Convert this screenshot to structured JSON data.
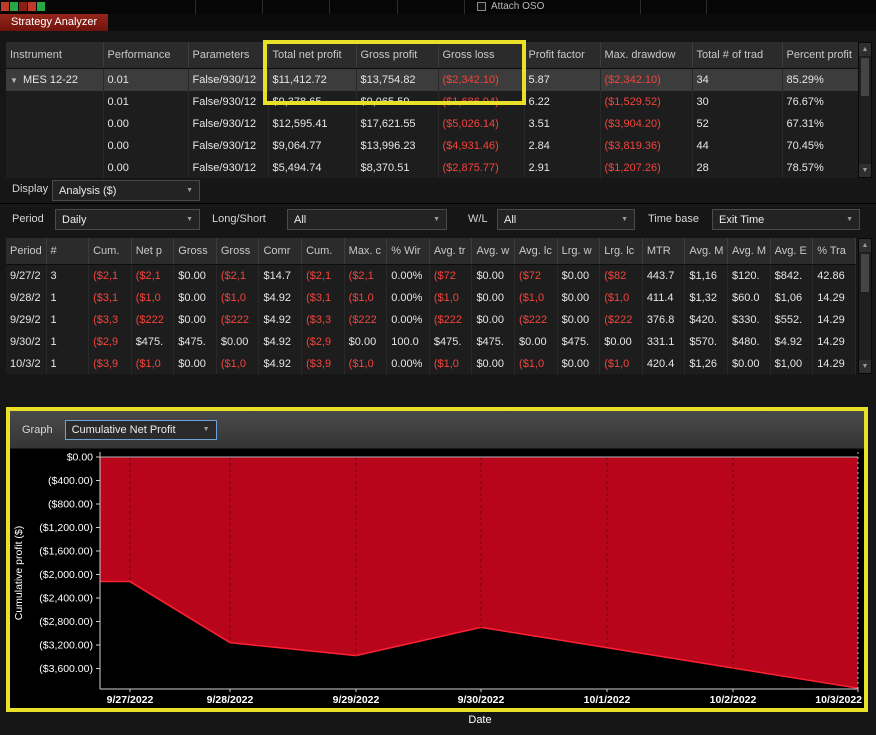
{
  "window": {
    "top_strip": {
      "attach_oso": "Attach OSO",
      "square_colors": [
        "#c0392b",
        "#27a844",
        "#8a1f14",
        "#c0392b",
        "#27a844"
      ]
    },
    "tab": "Strategy Analyzer"
  },
  "colors": {
    "highlight_yellow": "#e9e127",
    "negative_red": "#f2453d",
    "tab_maroon": "#7d1b15",
    "chart_fill": "#b8051c",
    "chart_line": "#ff2233"
  },
  "results_table": {
    "columns": [
      "Instrument",
      "Performance",
      "Parameters",
      "Total net profit",
      "Gross profit",
      "Gross loss",
      "Profit factor",
      "Max. drawdow",
      "Total # of trad",
      "Percent profit"
    ],
    "rows": [
      {
        "selected": true,
        "expanded": true,
        "cells": [
          "MES 12-22",
          "0.01",
          "False/930/12",
          "$11,412.72",
          "$13,754.82",
          "($2,342.10)",
          "5.87",
          "($2,342.10)",
          "34",
          "85.29%"
        ]
      },
      {
        "cells": [
          "",
          "0.01",
          "False/930/12",
          "$9,378.65",
          "$9,065.59",
          "($1,686.94)",
          "6.22",
          "($1,529.52)",
          "30",
          "76.67%"
        ]
      },
      {
        "cells": [
          "",
          "0.00",
          "False/930/12",
          "$12,595.41",
          "$17,621.55",
          "($5,026.14)",
          "3.51",
          "($3,904.20)",
          "52",
          "67.31%"
        ]
      },
      {
        "cells": [
          "",
          "0.00",
          "False/930/12",
          "$9,064.77",
          "$13,996.23",
          "($4,931.46)",
          "2.84",
          "($3,819.36)",
          "44",
          "70.45%"
        ]
      },
      {
        "cells": [
          "",
          "0.00",
          "False/930/12",
          "$5,494.74",
          "$8,370.51",
          "($2,875.77)",
          "2.91",
          "($1,207.26)",
          "28",
          "78.57%"
        ]
      }
    ]
  },
  "display": {
    "label": "Display",
    "value": "Analysis ($)"
  },
  "filters": [
    {
      "label": "Period",
      "value": "Daily"
    },
    {
      "label": "Long/Short",
      "value": "All"
    },
    {
      "label": "W/L",
      "value": "All"
    },
    {
      "label": "Time base",
      "value": "Exit Time"
    }
  ],
  "periods_table": {
    "columns": [
      "Period",
      "#",
      "Cum.",
      "Net p",
      "Gross",
      "Gross",
      "Comr",
      "Cum.",
      "Max. c",
      "% Wir",
      "Avg. tr",
      "Avg. w",
      "Avg. lc",
      "Lrg. w",
      "Lrg. lc",
      "MTR",
      "Avg. M",
      "Avg. M",
      "Avg. E",
      "% Tra"
    ],
    "rows": [
      [
        "9/27/2",
        "3",
        "($2,1",
        "($2,1",
        "$0.00",
        "($2,1",
        "$14.7",
        "($2,1",
        "($2,1",
        "0.00%",
        "($72",
        "$0.00",
        "($72",
        "$0.00",
        "($82",
        "443.7",
        "$1,16",
        "$120.",
        "$842.",
        "42.86"
      ],
      [
        "9/28/2",
        "1",
        "($3,1",
        "($1,0",
        "$0.00",
        "($1,0",
        "$4.92",
        "($3,1",
        "($1,0",
        "0.00%",
        "($1,0",
        "$0.00",
        "($1,0",
        "$0.00",
        "($1,0",
        "411.4",
        "$1,32",
        "$60.0",
        "$1,06",
        "14.29"
      ],
      [
        "9/29/2",
        "1",
        "($3,3",
        "($222",
        "$0.00",
        "($222",
        "$4.92",
        "($3,3",
        "($222",
        "0.00%",
        "($222",
        "$0.00",
        "($222",
        "$0.00",
        "($222",
        "376.8",
        "$420.",
        "$330.",
        "$552.",
        "14.29"
      ],
      [
        "9/30/2",
        "1",
        "($2,9",
        "$475.",
        "$475.",
        "$0.00",
        "$4.92",
        "($2,9",
        "$0.00",
        "100.0",
        "$475.",
        "$475.",
        "$0.00",
        "$475.",
        "$0.00",
        "331.1",
        "$570.",
        "$480.",
        "$4.92",
        "14.29"
      ],
      [
        "10/3/2",
        "1",
        "($3,9",
        "($1,0",
        "$0.00",
        "($1,0",
        "$4.92",
        "($3,9",
        "($1,0",
        "0.00%",
        "($1,0",
        "$0.00",
        "($1,0",
        "$0.00",
        "($1,0",
        "420.4",
        "$1,26",
        "$0.00",
        "$1,00",
        "14.29"
      ]
    ]
  },
  "graph": {
    "label": "Graph",
    "value": "Cumulative Net Profit"
  },
  "chart_data": {
    "type": "area",
    "title": "",
    "xlabel": "Date",
    "ylabel": "Cumulative profit ($)",
    "x_ticks": [
      "9/27/2022",
      "9/28/2022",
      "9/29/2022",
      "9/30/2022",
      "10/1/2022",
      "10/2/2022",
      "10/3/2022"
    ],
    "y_tick_labels": [
      "$0.00",
      "($400.00)",
      "($800.00)",
      "($1,200.00)",
      "($1,600.00)",
      "($2,000.00)",
      "($2,400.00)",
      "($2,800.00)",
      "($3,200.00)",
      "($3,600.00)"
    ],
    "y_tick_values": [
      0,
      -400,
      -800,
      -1200,
      -1600,
      -2000,
      -2400,
      -2800,
      -3200,
      -3600
    ],
    "ylim": [
      -3950,
      0
    ],
    "baseline": 0,
    "grid": "vertical-dashed",
    "legend": "none",
    "series": [
      {
        "name": "Cumulative Net Profit",
        "points": [
          [
            "9/27/2022",
            -2120
          ],
          [
            "9/28/2022",
            -3160
          ],
          [
            "9/29/2022",
            -3380
          ],
          [
            "9/30/2022",
            -2900
          ],
          [
            "10/3/2022",
            -3935
          ]
        ]
      }
    ]
  }
}
